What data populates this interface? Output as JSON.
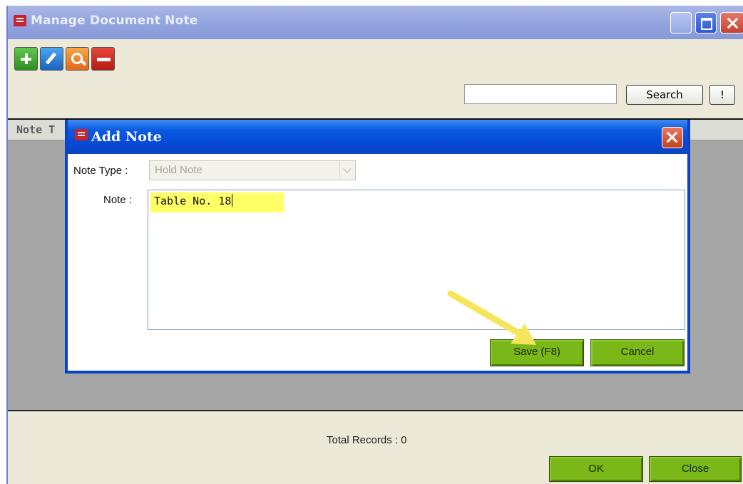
{
  "window": {
    "title": "Manage Document Note"
  },
  "search": {
    "value": "",
    "button_label": "Search",
    "extra_label": "!"
  },
  "grid": {
    "columns": [
      "Note T"
    ]
  },
  "footer": {
    "total_records": "Total Records : 0",
    "ok_label": "OK",
    "close_label": "Close"
  },
  "dialog": {
    "title": "Add Note",
    "note_type_label": "Note Type :",
    "note_type_value": "Hold Note",
    "note_label": "Note :",
    "note_value": "Table No. 18",
    "save_label": "Save (F8)",
    "cancel_label": "Cancel"
  },
  "toolbar": {
    "icons": [
      "add-icon",
      "edit-icon",
      "view-icon",
      "delete-icon"
    ]
  },
  "colors": {
    "title_bar_inactive": "#95a6e0",
    "dialog_title": "#0449d6",
    "button_green": "#7ab718",
    "highlight": "#ffff66",
    "annotation_arrow": "#f5e55a"
  }
}
